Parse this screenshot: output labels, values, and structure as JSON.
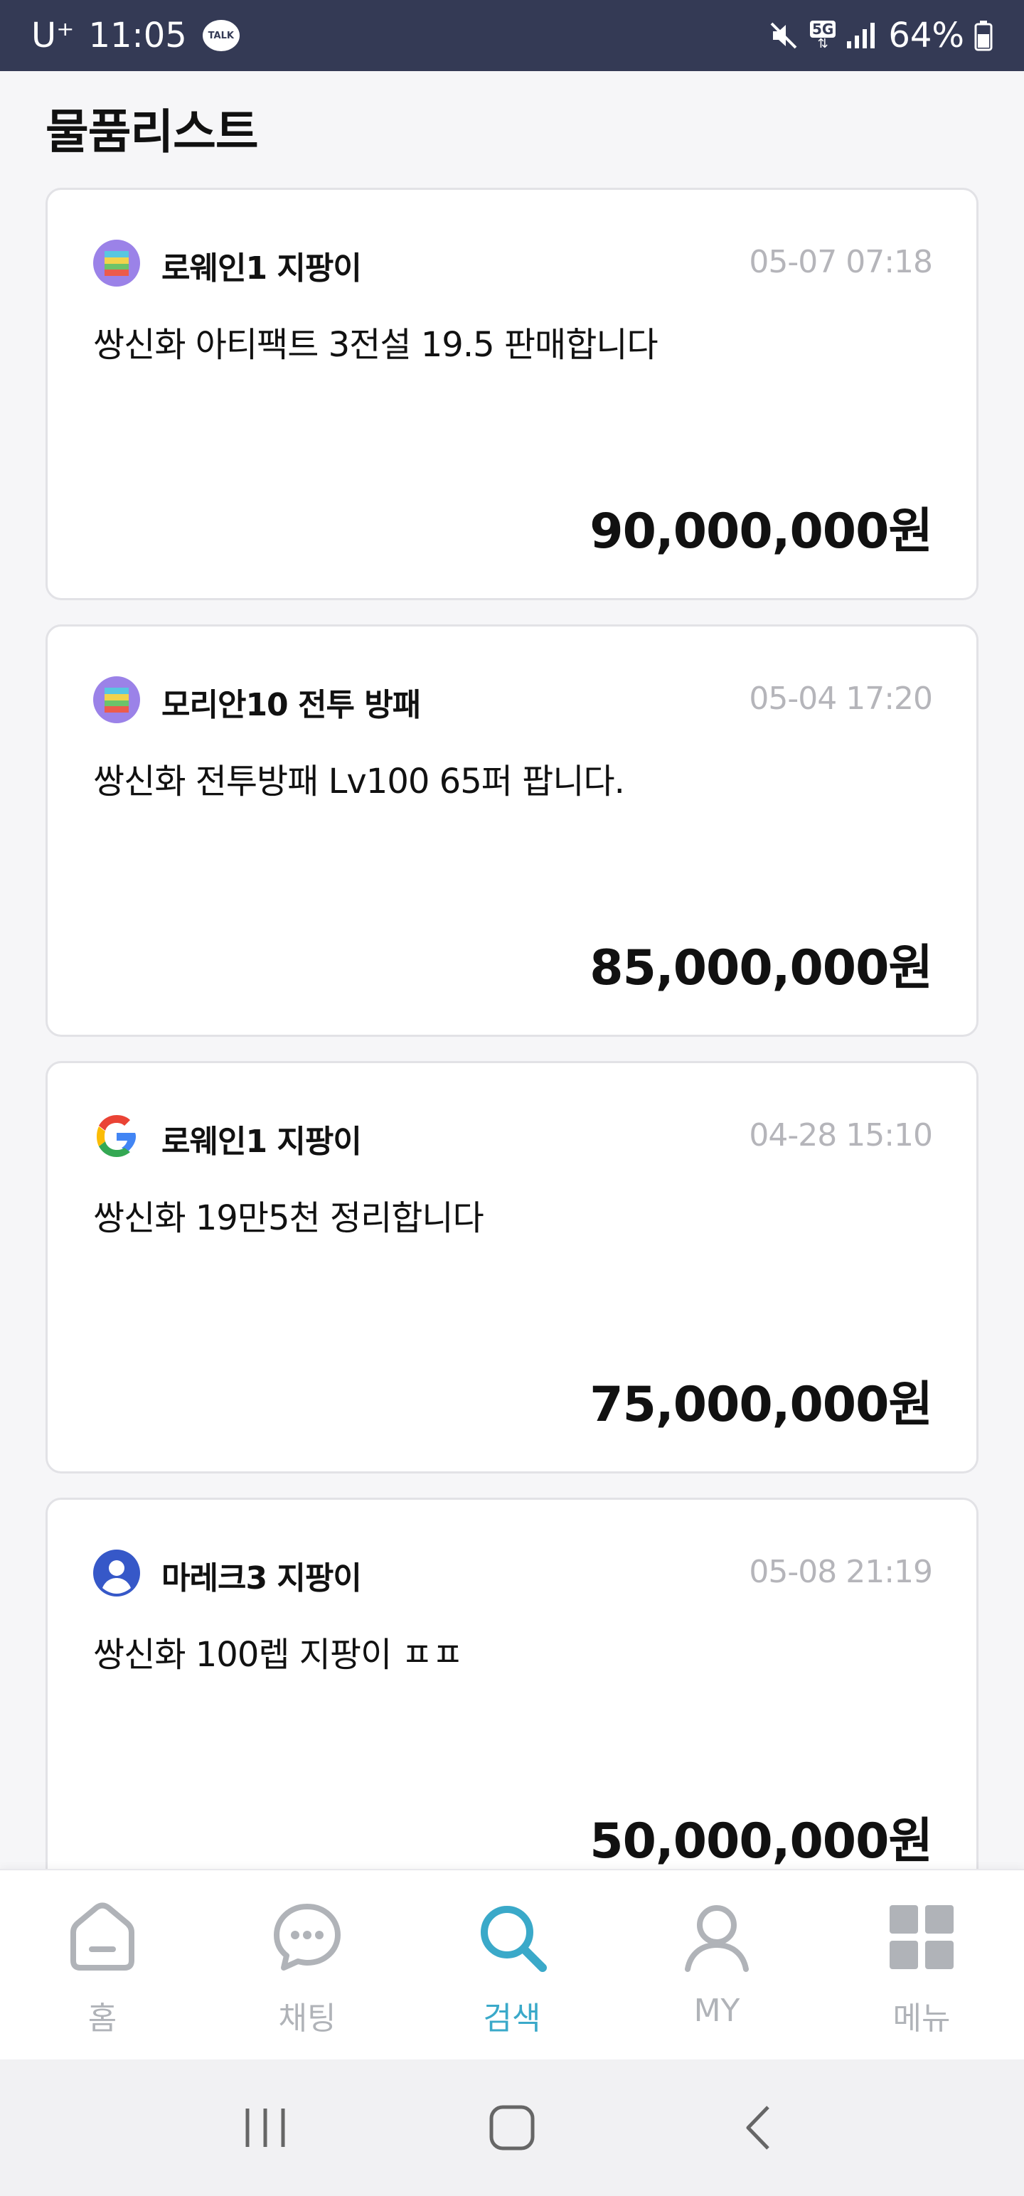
{
  "status_bar": {
    "carrier": "U⁺",
    "time": "11:05",
    "notification_icon": "kakao-talk-icon",
    "notification_label": "TALK",
    "network": "5G",
    "battery_percent": "64%"
  },
  "page": {
    "title": "물품리스트"
  },
  "listings": [
    {
      "avatar_icon": "colorful-avatar-icon",
      "server": "로웨인1 지팡이",
      "date": "05-07 07:18",
      "title": "쌍신화 아티팩트 3전설 19.5 판매합니다",
      "price": "90,000,000원"
    },
    {
      "avatar_icon": "colorful-avatar-icon",
      "server": "모리안10 전투 방패",
      "date": "05-04 17:20",
      "title": "쌍신화 전투방패 Lv100 65퍼 팝니다.",
      "price": "85,000,000원"
    },
    {
      "avatar_icon": "google-icon",
      "server": "로웨인1 지팡이",
      "date": "04-28 15:10",
      "title": "쌍신화 19만5천 정리합니다",
      "price": "75,000,000원"
    },
    {
      "avatar_icon": "user-avatar-icon",
      "server": "마레크3 지팡이",
      "date": "05-08 21:19",
      "title": "쌍신화 100렙 지팡이 ㅍㅍ",
      "price": "50,000,000원"
    }
  ],
  "bottom_nav": [
    {
      "label": "홈",
      "icon": "home-icon",
      "active": false
    },
    {
      "label": "채팅",
      "icon": "chat-icon",
      "active": false
    },
    {
      "label": "검색",
      "icon": "search-icon",
      "active": true
    },
    {
      "label": "MY",
      "icon": "person-icon",
      "active": false
    },
    {
      "label": "메뉴",
      "icon": "grid-menu-icon",
      "active": false
    }
  ],
  "colors": {
    "status_bar_bg": "#343a55",
    "accent": "#3aa9c9",
    "inactive": "#b0b3b8"
  }
}
